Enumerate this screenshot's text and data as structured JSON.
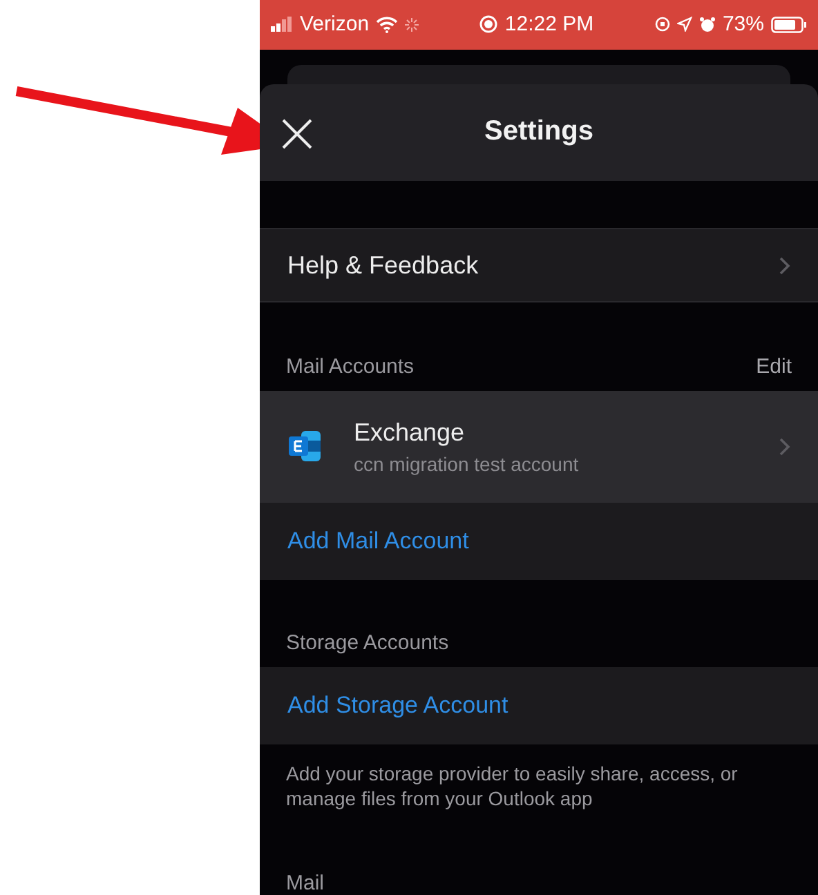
{
  "status_bar": {
    "carrier": "Verizon",
    "time": "12:22 PM",
    "battery": "73%"
  },
  "header": {
    "title": "Settings"
  },
  "help_row": {
    "label": "Help & Feedback"
  },
  "mail_accounts": {
    "heading": "Mail Accounts",
    "edit": "Edit",
    "accounts": [
      {
        "name": "Exchange",
        "description": "ccn migration test account"
      }
    ],
    "add": "Add Mail Account"
  },
  "storage_accounts": {
    "heading": "Storage Accounts",
    "add": "Add Storage Account",
    "note": "Add your storage provider to easily share, access, or manage files from your Outlook app"
  },
  "next_section": {
    "heading": "Mail"
  }
}
